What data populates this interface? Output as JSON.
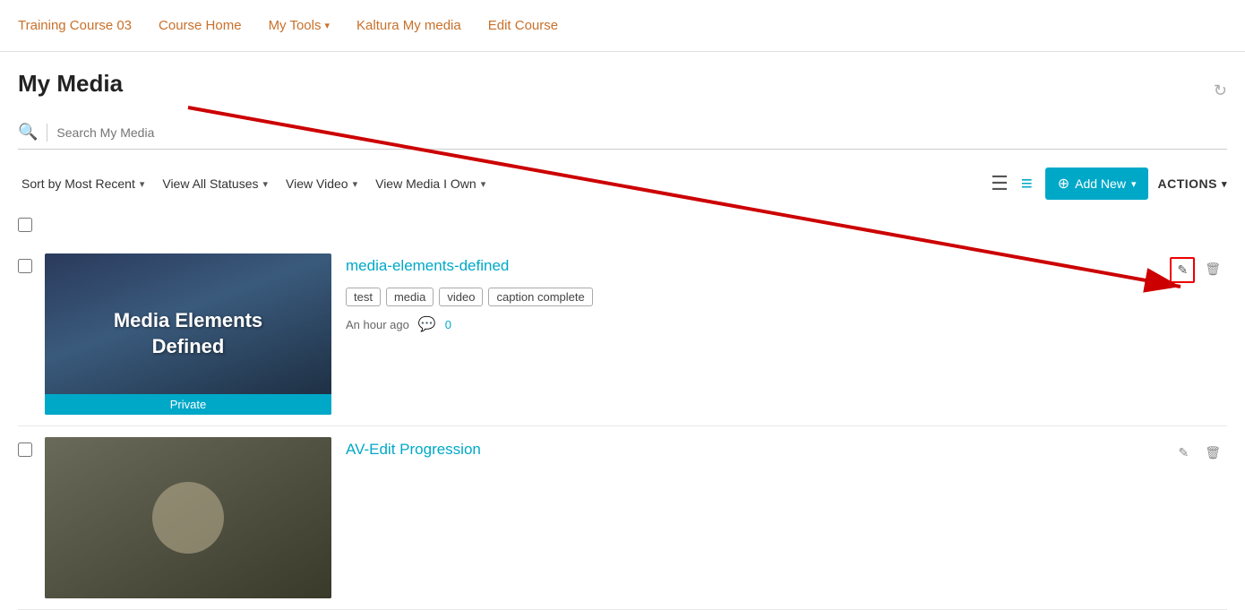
{
  "nav": {
    "items": [
      {
        "id": "training-course",
        "label": "Training Course 03",
        "active": false
      },
      {
        "id": "course-home",
        "label": "Course Home",
        "active": false
      },
      {
        "id": "my-tools",
        "label": "My Tools",
        "has_dropdown": true,
        "active": false
      },
      {
        "id": "kaltura-my-media",
        "label": "Kaltura My media",
        "active": false
      },
      {
        "id": "edit-course",
        "label": "Edit Course",
        "active": false
      }
    ]
  },
  "page": {
    "title": "My Media",
    "refresh_label": "↻"
  },
  "search": {
    "placeholder": "Search My Media"
  },
  "toolbar": {
    "sort_label": "Sort by Most Recent",
    "status_label": "View All Statuses",
    "type_label": "View Video",
    "owner_label": "View Media I Own",
    "add_new_label": "Add New",
    "actions_label": "ACTIONS"
  },
  "media_items": [
    {
      "id": "item-1",
      "title": "media-elements-defined",
      "thumbnail_text": "Media Elements\nDefined",
      "thumbnail_badge": "Private",
      "tags": [
        "test",
        "media",
        "video",
        "caption complete"
      ],
      "time": "An hour ago",
      "comments": "0",
      "has_edit": true
    },
    {
      "id": "item-2",
      "title": "AV-Edit Progression",
      "thumbnail_text": "",
      "thumbnail_badge": "",
      "tags": [],
      "time": "",
      "comments": "",
      "is_video": true
    }
  ],
  "icons": {
    "search": "🔍",
    "caret_down": "▾",
    "hamburger": "☰",
    "list": "≡",
    "plus_circle": "⊕",
    "comment": "💬",
    "edit": "✏",
    "delete": "🗑",
    "refresh": "↻"
  }
}
